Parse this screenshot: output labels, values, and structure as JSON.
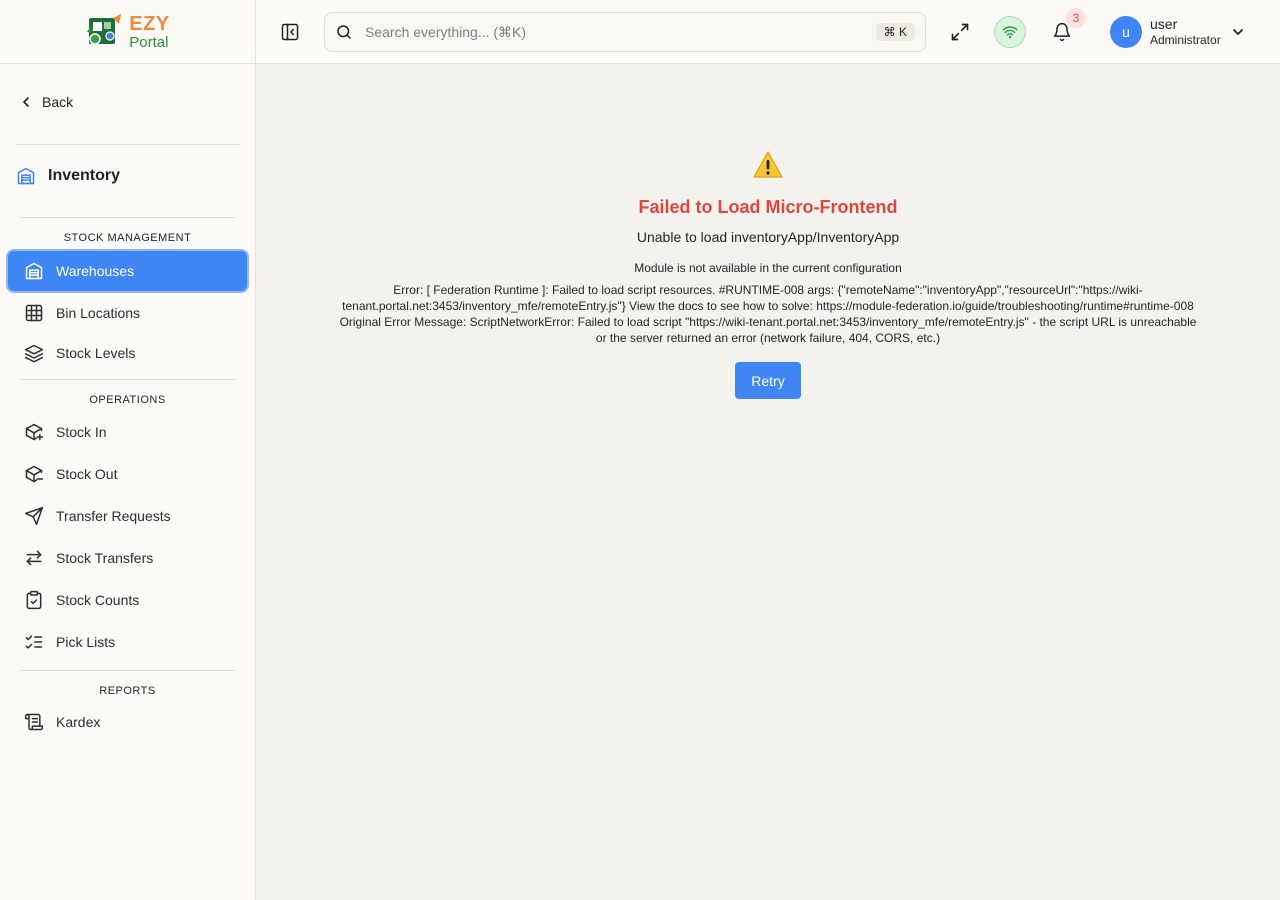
{
  "brand": {
    "ezy": "EZY",
    "portal": "Portal",
    "colors": {
      "ezy": "#ef8a3a",
      "portal": "#2e8b3a",
      "accent": "#3f86f4",
      "error": "#e0453f"
    }
  },
  "sidebar": {
    "back_label": "Back",
    "module_title": "Inventory",
    "sections": [
      {
        "label": "STOCK MANAGEMENT",
        "items": [
          {
            "label": "Warehouses",
            "icon": "warehouse-icon",
            "active": true
          },
          {
            "label": "Bin Locations",
            "icon": "grid-icon"
          },
          {
            "label": "Stock Levels",
            "icon": "layers-icon"
          }
        ]
      },
      {
        "label": "OPERATIONS",
        "items": [
          {
            "label": "Stock In",
            "icon": "package-plus-icon"
          },
          {
            "label": "Stock Out",
            "icon": "package-minus-icon"
          },
          {
            "label": "Transfer Requests",
            "icon": "send-icon"
          },
          {
            "label": "Stock Transfers",
            "icon": "arrows-left-right-icon"
          },
          {
            "label": "Stock Counts",
            "icon": "clipboard-check-icon"
          },
          {
            "label": "Pick Lists",
            "icon": "list-checks-icon"
          }
        ]
      },
      {
        "label": "REPORTS",
        "items": [
          {
            "label": "Kardex",
            "icon": "scroll-icon"
          }
        ]
      }
    ]
  },
  "topbar": {
    "search_placeholder": "Search everything... (⌘K)",
    "search_shortcut": "⌘ K",
    "notification_count": "3",
    "user": {
      "avatar_letter": "u",
      "name": "user",
      "role": "Administrator"
    }
  },
  "error": {
    "icon": "warning-icon",
    "title": "Failed to Load Micro-Frontend",
    "subtitle": "Unable to load inventoryApp/InventoryApp",
    "module_message": "Module is not available in the current configuration",
    "details": "Error: [ Federation Runtime ]: Failed to load script resources. #RUNTIME-008 args: {\"remoteName\":\"inventoryApp\",\"resourceUrl\":\"https://wiki-tenant.portal.net:3453/inventory_mfe/remoteEntry.js\"} View the docs to see how to solve: https://module-federation.io/guide/troubleshooting/runtime#runtime-008 Original Error Message: ScriptNetworkError: Failed to load script \"https://wiki-tenant.portal.net:3453/inventory_mfe/remoteEntry.js\" - the script URL is unreachable or the server returned an error (network failure, 404, CORS, etc.)",
    "retry_label": "Retry"
  }
}
